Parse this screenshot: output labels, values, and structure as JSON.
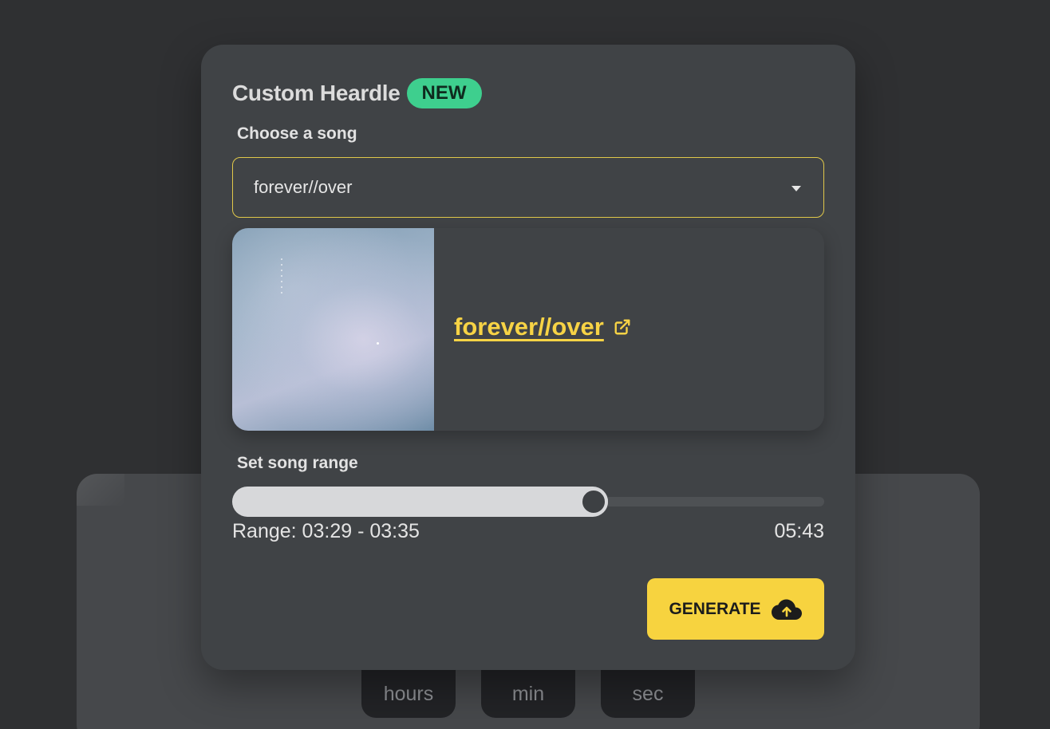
{
  "countdown": {
    "hours_label": "hours",
    "min_label": "min",
    "sec_label": "sec"
  },
  "modal": {
    "title": "Custom Heardle",
    "badge": "NEW",
    "choose_label": "Choose a song",
    "select": {
      "value": "forever//over",
      "icon": "caret-down-icon"
    },
    "song_card": {
      "title": "forever//over",
      "link_icon": "external-link-icon"
    },
    "range_label": "Set song range",
    "slider": {
      "position_fraction": 0.61
    },
    "range_text": "Range: 03:29 - 03:35",
    "total_time": "05:43",
    "generate_label": "GENERATE",
    "generate_icon": "cloud-upload-icon"
  },
  "colors": {
    "accent": "#f7d33f",
    "badge": "#3ecf8e",
    "background": "#2f3032",
    "modal": "#404346"
  }
}
